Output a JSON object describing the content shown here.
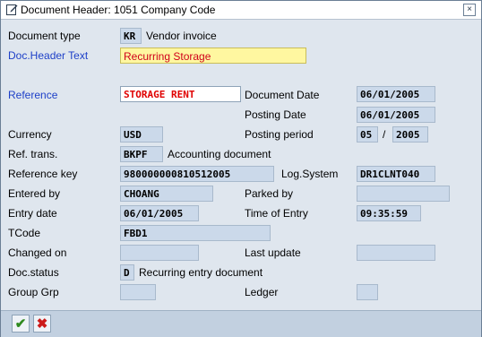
{
  "window": {
    "title": "Document Header: 1051 Company Code",
    "close_symbol": "×"
  },
  "fields": {
    "doc_type": {
      "label": "Document type",
      "value": "KR",
      "text": "Vendor invoice"
    },
    "doc_header_text": {
      "label": "Doc.Header Text",
      "value": "Recurring Storage"
    },
    "reference": {
      "label": "Reference",
      "value": "STORAGE RENT"
    },
    "document_date": {
      "label": "Document Date",
      "value": "06/01/2005"
    },
    "posting_date": {
      "label": "Posting Date",
      "value": "06/01/2005"
    },
    "currency": {
      "label": "Currency",
      "value": "USD"
    },
    "posting_period": {
      "label": "Posting period",
      "period": "05",
      "separator": "/",
      "year": "2005"
    },
    "ref_trans": {
      "label": "Ref. trans.",
      "value": "BKPF",
      "text": "Accounting document"
    },
    "reference_key": {
      "label": "Reference key",
      "value": "980000000810512005"
    },
    "log_system": {
      "label": "Log.System",
      "value": "DR1CLNT040"
    },
    "entered_by": {
      "label": "Entered by",
      "value": "CHOANG"
    },
    "parked_by": {
      "label": "Parked by",
      "value": ""
    },
    "entry_date": {
      "label": "Entry date",
      "value": "06/01/2005"
    },
    "time_of_entry": {
      "label": "Time of Entry",
      "value": "09:35:59"
    },
    "tcode": {
      "label": "TCode",
      "value": "FBD1"
    },
    "changed_on": {
      "label": "Changed on",
      "value": ""
    },
    "last_update": {
      "label": "Last update",
      "value": ""
    },
    "doc_status": {
      "label": "Doc.status",
      "value": "D",
      "text": "Recurring entry document"
    },
    "group_grp": {
      "label": "Group Grp",
      "value": ""
    },
    "ledger": {
      "label": "Ledger",
      "value": ""
    }
  },
  "footer": {
    "ok_icon": "✔",
    "cancel_icon": "✖"
  },
  "colors": {
    "label_link": "#1e40c8",
    "highlight_field": "#fff7a0",
    "readonly_field": "#cbd9ea",
    "reference_text": "#e00000"
  }
}
